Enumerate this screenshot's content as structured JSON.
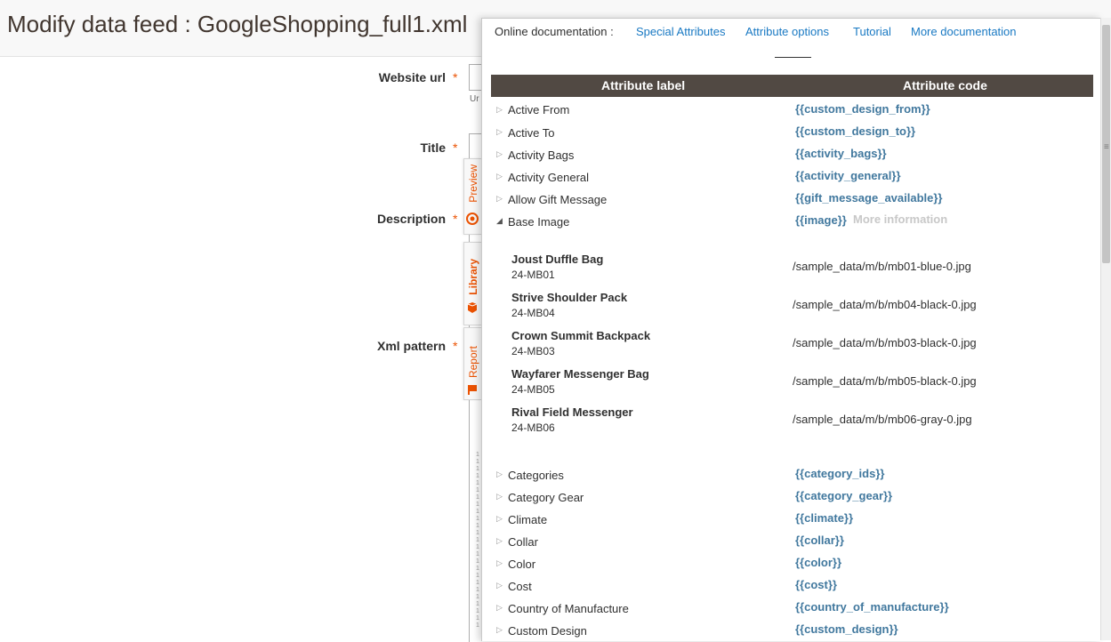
{
  "page": {
    "title": "Modify data feed : GoogleShopping_full1.xml"
  },
  "form": {
    "website_url_label": "Website url",
    "url_note": "Ur",
    "title_label": "Title",
    "description_label": "Description",
    "xml_pattern_label": "Xml pattern",
    "required_mark": "*",
    "line_numbers": "1\n1\n1\n1\n1\n1\n1\n1\n1\n1\n1\n1\n1\n1\n1\n1\n1\n1\n1\n1\n1\n1\n1\n1\n1"
  },
  "side_tabs": {
    "preview": "Preview",
    "library": "Library",
    "report": "Report"
  },
  "panel": {
    "doc_label": "Online documentation :",
    "doc_links": [
      "Special Attributes",
      "Attribute options",
      "Tutorial",
      "More documentation"
    ],
    "columns": {
      "label": "Attribute label",
      "code": "Attribute code"
    },
    "attributes_top": [
      {
        "label": "Active From",
        "code": "{{custom_design_from}}"
      },
      {
        "label": "Active To",
        "code": "{{custom_design_to}}"
      },
      {
        "label": "Activity Bags",
        "code": "{{activity_bags}}"
      },
      {
        "label": "Activity General",
        "code": "{{activity_general}}"
      },
      {
        "label": "Allow Gift Message",
        "code": "{{gift_message_available}}"
      },
      {
        "label": "Base Image",
        "code": "{{image}}"
      }
    ],
    "more_information": "More information",
    "samples": [
      {
        "name": "Joust Duffle Bag",
        "sku": "24-MB01",
        "path": "/sample_data/m/b/mb01-blue-0.jpg"
      },
      {
        "name": "Strive Shoulder Pack",
        "sku": "24-MB04",
        "path": "/sample_data/m/b/mb04-black-0.jpg"
      },
      {
        "name": "Crown Summit Backpack",
        "sku": "24-MB03",
        "path": "/sample_data/m/b/mb03-black-0.jpg"
      },
      {
        "name": "Wayfarer Messenger Bag",
        "sku": "24-MB05",
        "path": "/sample_data/m/b/mb05-black-0.jpg"
      },
      {
        "name": "Rival Field Messenger",
        "sku": "24-MB06",
        "path": "/sample_data/m/b/mb06-gray-0.jpg"
      }
    ],
    "attributes_bottom": [
      {
        "label": "Categories",
        "code": "{{category_ids}}"
      },
      {
        "label": "Category Gear",
        "code": "{{category_gear}}"
      },
      {
        "label": "Climate",
        "code": "{{climate}}"
      },
      {
        "label": "Collar",
        "code": "{{collar}}"
      },
      {
        "label": "Color",
        "code": "{{color}}"
      },
      {
        "label": "Cost",
        "code": "{{cost}}"
      },
      {
        "label": "Country of Manufacture",
        "code": "{{country_of_manufacture}}"
      },
      {
        "label": "Custom Design",
        "code": "{{custom_design}}"
      }
    ]
  },
  "icons": {
    "collapsed_arrow": "▷",
    "expanded_arrow": "◢",
    "scroll_grip": "≡"
  },
  "colors": {
    "accent": "#eb5202",
    "link": "#1979c3",
    "code": "#41789e",
    "table_header": "#514943"
  }
}
